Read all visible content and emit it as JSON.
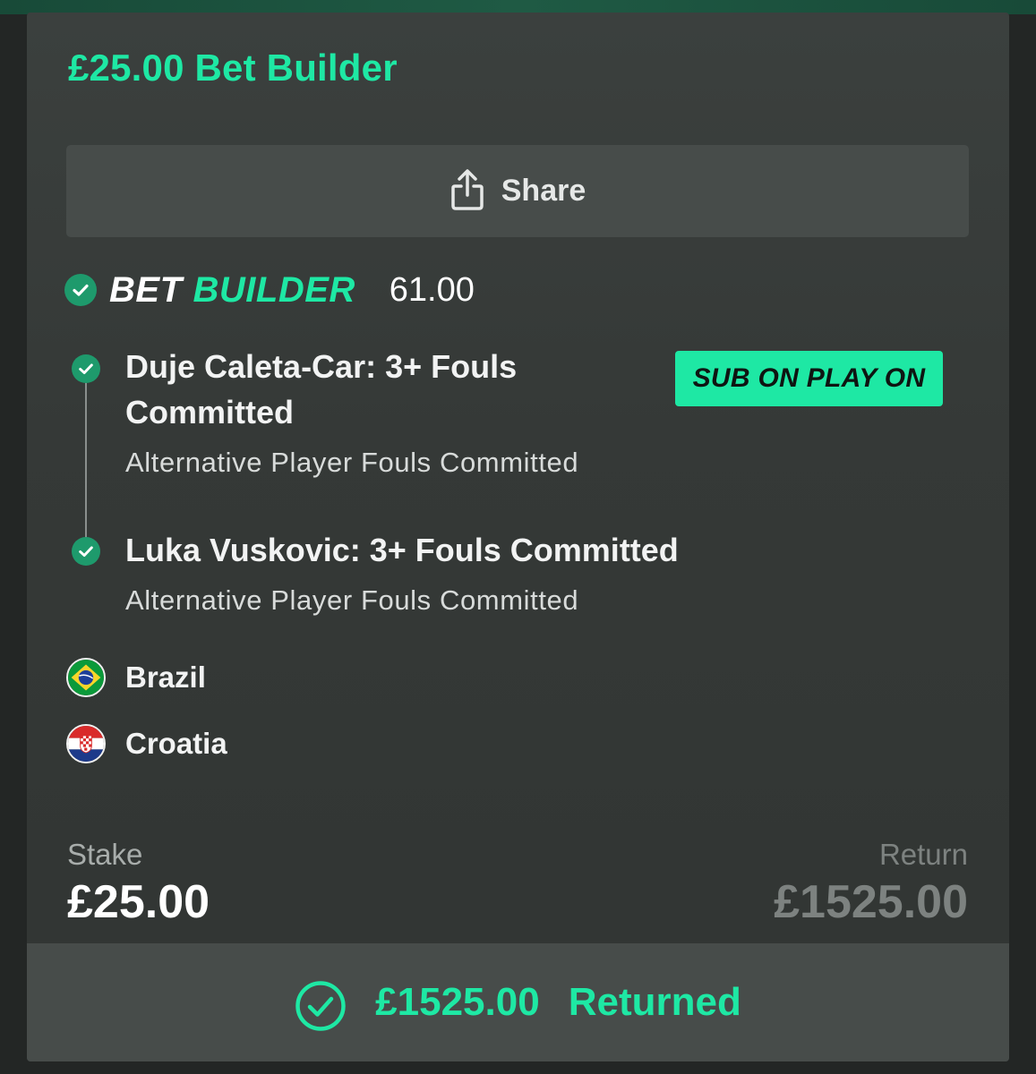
{
  "title": "£25.00 Bet Builder",
  "share": {
    "label": "Share",
    "icon": "share-icon"
  },
  "bet_builder": {
    "label_first": "BET",
    "label_second": "BUILDER",
    "odds": "61.00",
    "status_icon": "check-circle-icon"
  },
  "badge": "SUB ON PLAY ON",
  "legs": [
    {
      "title_line1": "Duje Caleta-Car: 3+ Fouls",
      "title_line2": "Committed",
      "market": "Alternative Player Fouls Committed",
      "status_icon": "check-circle-icon"
    },
    {
      "title_line1": "Luka Vuskovic: 3+ Fouls Committed",
      "market": "Alternative Player Fouls Committed",
      "status_icon": "check-circle-icon"
    }
  ],
  "teams": [
    {
      "name": "Brazil",
      "flag": "brazil-flag-icon"
    },
    {
      "name": "Croatia",
      "flag": "croatia-flag-icon"
    }
  ],
  "stake": {
    "label": "Stake",
    "value": "£25.00"
  },
  "return": {
    "label": "Return",
    "value": "£1525.00"
  },
  "result": {
    "amount": "£1525.00",
    "status": "Returned",
    "icon": "check-circle-outline-icon"
  },
  "colors": {
    "accent": "#1ee8a4",
    "check_fill": "#1e9a6c",
    "card_bg": "#353937",
    "button_bg": "#474c4a",
    "muted_text": "#7d8280"
  }
}
